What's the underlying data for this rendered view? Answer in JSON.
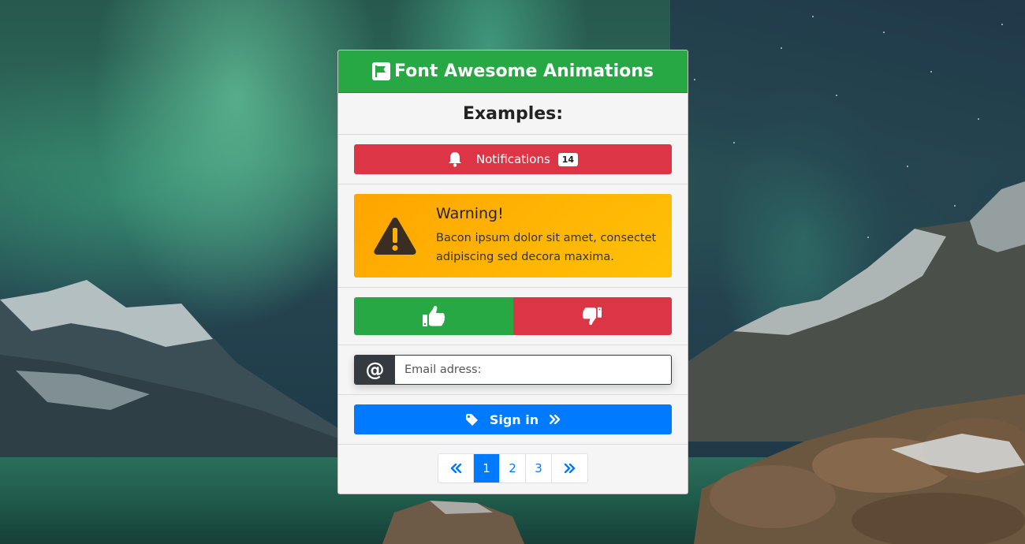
{
  "header": {
    "title": "Font Awesome Animations",
    "icon": "flag-icon"
  },
  "subtitle": "Examples:",
  "notifications": {
    "label": "Notifications",
    "count": "14",
    "icon": "bell-icon"
  },
  "warning": {
    "title": "Warning!",
    "text": "Bacon ipsum dolor sit amet, consectet adipiscing sed decora maxima.",
    "icon": "exclamation-triangle-icon"
  },
  "votes": {
    "up_icon": "thumbs-up-icon",
    "down_icon": "thumbs-down-icon"
  },
  "email": {
    "icon": "at-icon",
    "symbol": "@",
    "placeholder": "Email adress:"
  },
  "signin": {
    "label": "Sign in",
    "icon": "tag-icon",
    "arrow_icon": "angle-double-right-icon"
  },
  "pagination": {
    "pages": [
      "1",
      "2",
      "3"
    ],
    "active": "1"
  },
  "colors": {
    "success": "#28a745",
    "danger": "#dc3545",
    "warning": "#ffc107",
    "primary": "#007bff",
    "dark": "#343a40"
  }
}
